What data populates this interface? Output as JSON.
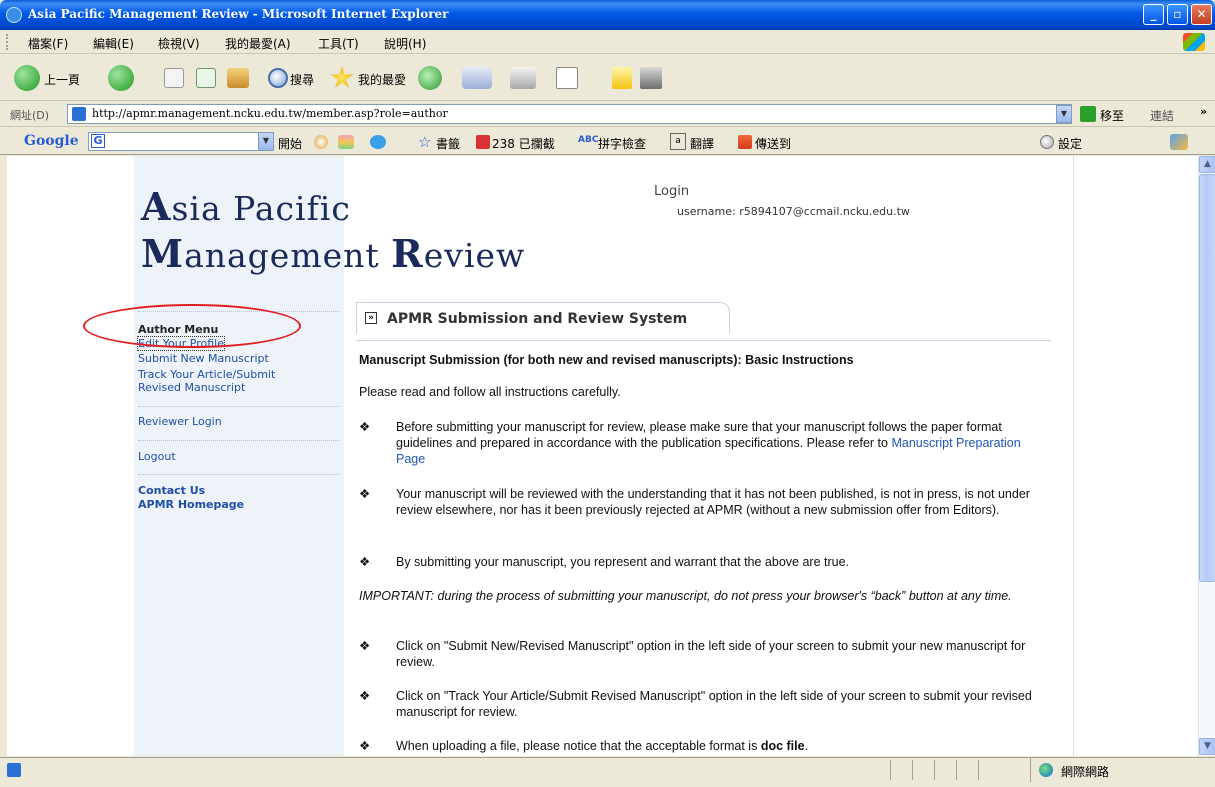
{
  "window": {
    "title": "Asia Pacific Management Review - Microsoft Internet Explorer",
    "minimize": "_",
    "maximize": "▫",
    "close": "✕"
  },
  "menubar": {
    "items": [
      "檔案(F)",
      "編輯(E)",
      "檢視(V)",
      "我的最愛(A)",
      "工具(T)",
      "說明(H)"
    ]
  },
  "toolbar": {
    "back_label": "上一頁",
    "search_label": "搜尋",
    "favorites_label": "我的最愛"
  },
  "addressbar": {
    "label": "網址(D)",
    "url": "http://apmr.management.ncku.edu.tw/member.asp?role=author",
    "go_label": "移至",
    "links_label": "連結"
  },
  "googlebar": {
    "logo": "Google",
    "g_button": "G",
    "start_label": "開始",
    "bookmarks_label": "書籤",
    "blocked_label": "238 已攔截",
    "spellcheck_label": "拼字檢查",
    "translate_label": "翻譯",
    "sendto_label": "傳送到",
    "settings_label": "設定"
  },
  "page": {
    "logo_line1_cap": "A",
    "logo_line1_rest": "sia Pacific",
    "logo_line2_cap1": "M",
    "logo_line2_rest1": "anagement ",
    "logo_line2_cap2": "R",
    "logo_line2_rest2": "eview",
    "login_title": "Login",
    "login_user": "username: r5894107@ccmail.ncku.edu.tw"
  },
  "sidebar": {
    "heading": "Author Menu",
    "edit_profile": "Edit Your Profile",
    "submit_new": "Submit New Manuscript",
    "track_line1": "Track Your Article/Submit",
    "track_line2": "Revised Manuscript",
    "reviewer_login": "Reviewer Login",
    "logout": "Logout",
    "contact_us": "Contact Us",
    "apmr_homepage": "APMR Homepage"
  },
  "main": {
    "tab_title": "APMR Submission and Review System",
    "bullet_symbol": "»",
    "heading": "Manuscript Submission (for both new and revised manuscripts): Basic Instructions",
    "intro": "Please read and follow all instructions carefully.",
    "diamond": "❖",
    "b1_text": "Before submitting your manuscript for review, please make sure that your manuscript follows the paper format guidelines and prepared in accordance with the publication specifications. Please refer to",
    "b1_link": "Manuscript Preparation Page",
    "b2_text": "Your manuscript will be reviewed with the understanding that it has not been published, is not in press, is not under review elsewhere, nor has it been previously rejected at APMR (without a new submission offer from Editors).",
    "b3_text": "By submitting your manuscript, you represent and warrant that the above are true.",
    "important": "IMPORTANT: during the process of submitting your manuscript, do not press your browser's “back” button at any time.",
    "b4_text": "Click on \"Submit New/Revised Manuscript\" option in the left side of your screen to submit your new manuscript for review.",
    "b5_text": "Click on \"Track Your Article/Submit Revised Manuscript\" option in the left side of your screen to submit your revised manuscript for review.",
    "b6_text": "When uploading a file, please notice that the acceptable format is ",
    "b6_bold": "doc file",
    "b6_end": "."
  },
  "statusbar": {
    "zone": "網際網路"
  },
  "colors": {
    "titlebar": "#0058e6",
    "sidebar_bg": "#eef3fa",
    "link": "#1f4ea8",
    "annotation": "#e02020"
  }
}
